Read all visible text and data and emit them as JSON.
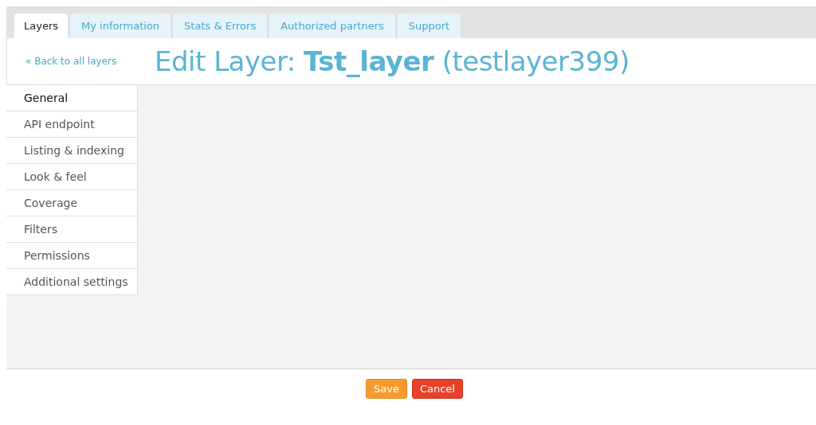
{
  "tabs": [
    {
      "label": "Layers",
      "selected": true
    },
    {
      "label": "My information",
      "selected": false
    },
    {
      "label": "Stats & Errors",
      "selected": false
    },
    {
      "label": "Authorized partners",
      "selected": false
    },
    {
      "label": "Support",
      "selected": false
    }
  ],
  "header": {
    "back_link": "« Back to all layers",
    "title": "Edit Layer: **Tst_layer** (testlayer399)"
  },
  "sidebar": {
    "items": [
      {
        "label": "General",
        "selected": true
      },
      {
        "label": "API endpoint",
        "selected": false
      },
      {
        "label": "Listing & indexing",
        "selected": false
      },
      {
        "label": "Look & feel",
        "selected": false
      },
      {
        "label": "Coverage",
        "selected": false
      },
      {
        "label": "Filters",
        "selected": false
      },
      {
        "label": "Permissions",
        "selected": false
      },
      {
        "label": "Additional settings",
        "selected": false
      }
    ]
  },
  "buttons": [
    {
      "label": "Save",
      "kind": "primary"
    },
    {
      "label": "Cancel",
      "kind": "danger"
    }
  ]
}
